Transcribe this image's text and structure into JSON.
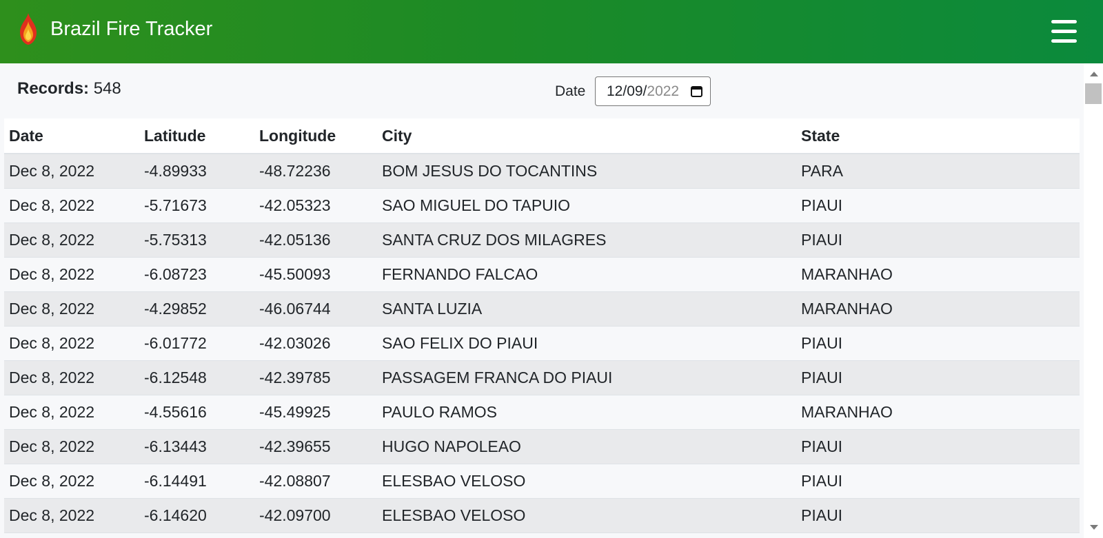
{
  "header": {
    "title": "Brazil Fire Tracker",
    "logo_icon": "flame-icon",
    "menu_icon": "hamburger-menu-icon",
    "accent_color": "#1c8a26"
  },
  "summary": {
    "records_label": "Records:",
    "records_value": "548"
  },
  "date_filter": {
    "label": "Date",
    "value_main": "12/09/",
    "value_year": "2022"
  },
  "table": {
    "columns": [
      "Date",
      "Latitude",
      "Longitude",
      "City",
      "State"
    ],
    "rows": [
      {
        "date": "Dec 8, 2022",
        "lat": "-4.89933",
        "lon": "-48.72236",
        "city": "BOM JESUS DO TOCANTINS",
        "state": "PARA"
      },
      {
        "date": "Dec 8, 2022",
        "lat": "-5.71673",
        "lon": "-42.05323",
        "city": "SAO MIGUEL DO TAPUIO",
        "state": "PIAUI"
      },
      {
        "date": "Dec 8, 2022",
        "lat": "-5.75313",
        "lon": "-42.05136",
        "city": "SANTA CRUZ DOS MILAGRES",
        "state": "PIAUI"
      },
      {
        "date": "Dec 8, 2022",
        "lat": "-6.08723",
        "lon": "-45.50093",
        "city": "FERNANDO FALCAO",
        "state": "MARANHAO"
      },
      {
        "date": "Dec 8, 2022",
        "lat": "-4.29852",
        "lon": "-46.06744",
        "city": "SANTA LUZIA",
        "state": "MARANHAO"
      },
      {
        "date": "Dec 8, 2022",
        "lat": "-6.01772",
        "lon": "-42.03026",
        "city": "SAO FELIX DO PIAUI",
        "state": "PIAUI"
      },
      {
        "date": "Dec 8, 2022",
        "lat": "-6.12548",
        "lon": "-42.39785",
        "city": "PASSAGEM FRANCA DO PIAUI",
        "state": "PIAUI"
      },
      {
        "date": "Dec 8, 2022",
        "lat": "-4.55616",
        "lon": "-45.49925",
        "city": "PAULO RAMOS",
        "state": "MARANHAO"
      },
      {
        "date": "Dec 8, 2022",
        "lat": "-6.13443",
        "lon": "-42.39655",
        "city": "HUGO NAPOLEAO",
        "state": "PIAUI"
      },
      {
        "date": "Dec 8, 2022",
        "lat": "-6.14491",
        "lon": "-42.08807",
        "city": "ELESBAO VELOSO",
        "state": "PIAUI"
      },
      {
        "date": "Dec 8, 2022",
        "lat": "-6.14620",
        "lon": "-42.09700",
        "city": "ELESBAO VELOSO",
        "state": "PIAUI"
      }
    ]
  }
}
